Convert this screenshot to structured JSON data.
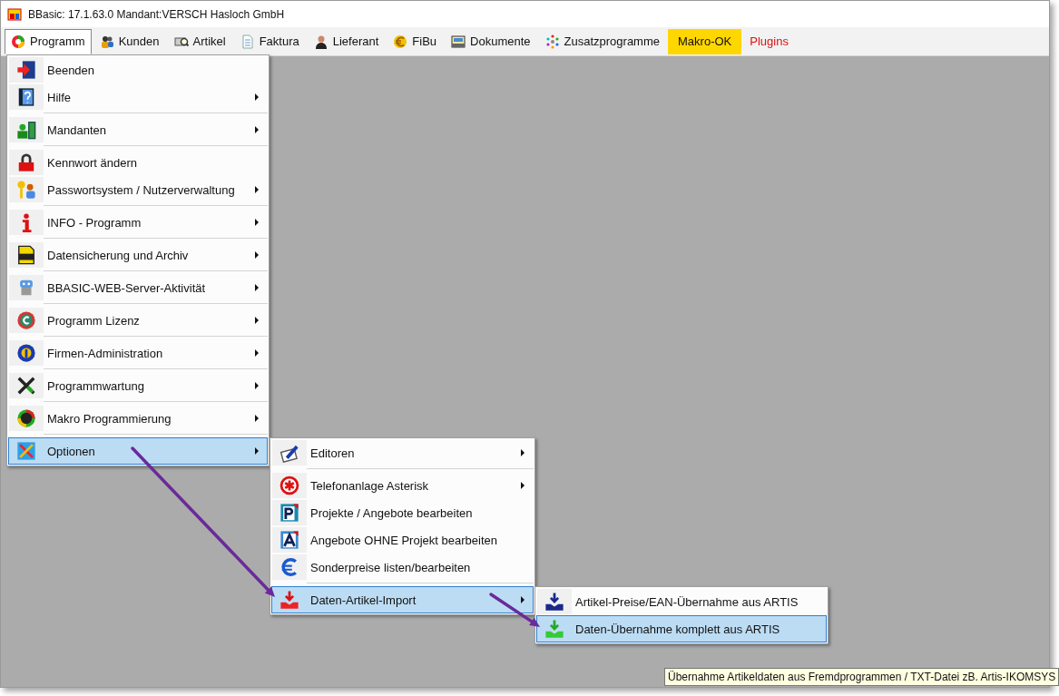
{
  "window": {
    "title": "BBasic: 17.1.63.0 Mandant:VERSCH Hasloch GmbH"
  },
  "menubar": {
    "items": [
      {
        "label": "Programm",
        "kind": "icon",
        "selected": true
      },
      {
        "label": "Kunden",
        "kind": "icon",
        "selected": false
      },
      {
        "label": "Artikel",
        "kind": "icon",
        "selected": false
      },
      {
        "label": "Faktura",
        "kind": "icon",
        "selected": false
      },
      {
        "label": "Lieferant",
        "kind": "icon",
        "selected": false
      },
      {
        "label": "FiBu",
        "kind": "icon",
        "selected": false
      },
      {
        "label": "Dokumente",
        "kind": "icon",
        "selected": false
      },
      {
        "label": "Zusatzprogramme",
        "kind": "icon",
        "selected": false
      },
      {
        "label": "Makro-OK",
        "kind": "highlight",
        "selected": false
      },
      {
        "label": "Plugins",
        "kind": "alert",
        "selected": false
      }
    ]
  },
  "menus": [
    {
      "items": [
        {
          "label": "Beenden",
          "has_submenu": false,
          "divider_above": false,
          "selected": false
        },
        {
          "label": "Hilfe",
          "has_submenu": true,
          "divider_above": false,
          "selected": false
        },
        {
          "label": "Mandanten",
          "has_submenu": true,
          "divider_above": true,
          "selected": false
        },
        {
          "label": "Kennwort ändern",
          "has_submenu": false,
          "divider_above": true,
          "selected": false
        },
        {
          "label": "Passwortsystem / Nutzerverwaltung",
          "has_submenu": true,
          "divider_above": false,
          "selected": false
        },
        {
          "label": "INFO - Programm",
          "has_submenu": true,
          "divider_above": true,
          "selected": false
        },
        {
          "label": "Datensicherung und Archiv",
          "has_submenu": true,
          "divider_above": true,
          "selected": false
        },
        {
          "label": "BBASIC-WEB-Server-Aktivität",
          "has_submenu": true,
          "divider_above": true,
          "selected": false
        },
        {
          "label": "Programm Lizenz",
          "has_submenu": true,
          "divider_above": true,
          "selected": false
        },
        {
          "label": "Firmen-Administration",
          "has_submenu": true,
          "divider_above": true,
          "selected": false
        },
        {
          "label": "Programmwartung",
          "has_submenu": true,
          "divider_above": true,
          "selected": false
        },
        {
          "label": "Makro Programmierung",
          "has_submenu": true,
          "divider_above": true,
          "selected": false
        },
        {
          "label": "Optionen",
          "has_submenu": true,
          "divider_above": true,
          "selected": true
        }
      ]
    },
    {
      "items": [
        {
          "label": "Editoren",
          "has_submenu": true,
          "divider_above": false,
          "selected": false
        },
        {
          "label": "Telefonanlage Asterisk",
          "has_submenu": true,
          "divider_above": true,
          "selected": false
        },
        {
          "label": "Projekte / Angebote bearbeiten",
          "has_submenu": false,
          "divider_above": false,
          "selected": false
        },
        {
          "label": "Angebote OHNE Projekt bearbeiten",
          "has_submenu": false,
          "divider_above": false,
          "selected": false
        },
        {
          "label": "Sonderpreise listen/bearbeiten",
          "has_submenu": false,
          "divider_above": false,
          "selected": false
        },
        {
          "label": "Daten-Artikel-Import",
          "has_submenu": true,
          "divider_above": true,
          "selected": true
        }
      ]
    },
    {
      "items": [
        {
          "label": "Artikel-Preise/EAN-Übernahme aus ARTIS",
          "has_submenu": false,
          "divider_above": false,
          "selected": false
        },
        {
          "label": "Daten-Übernahme komplett aus ARTIS",
          "has_submenu": false,
          "divider_above": false,
          "selected": true
        }
      ]
    }
  ],
  "tooltip": {
    "text": "Übernahme Artikeldaten aus Fremdprogrammen / TXT-Datei zB. Artis-IKOMSYS"
  }
}
